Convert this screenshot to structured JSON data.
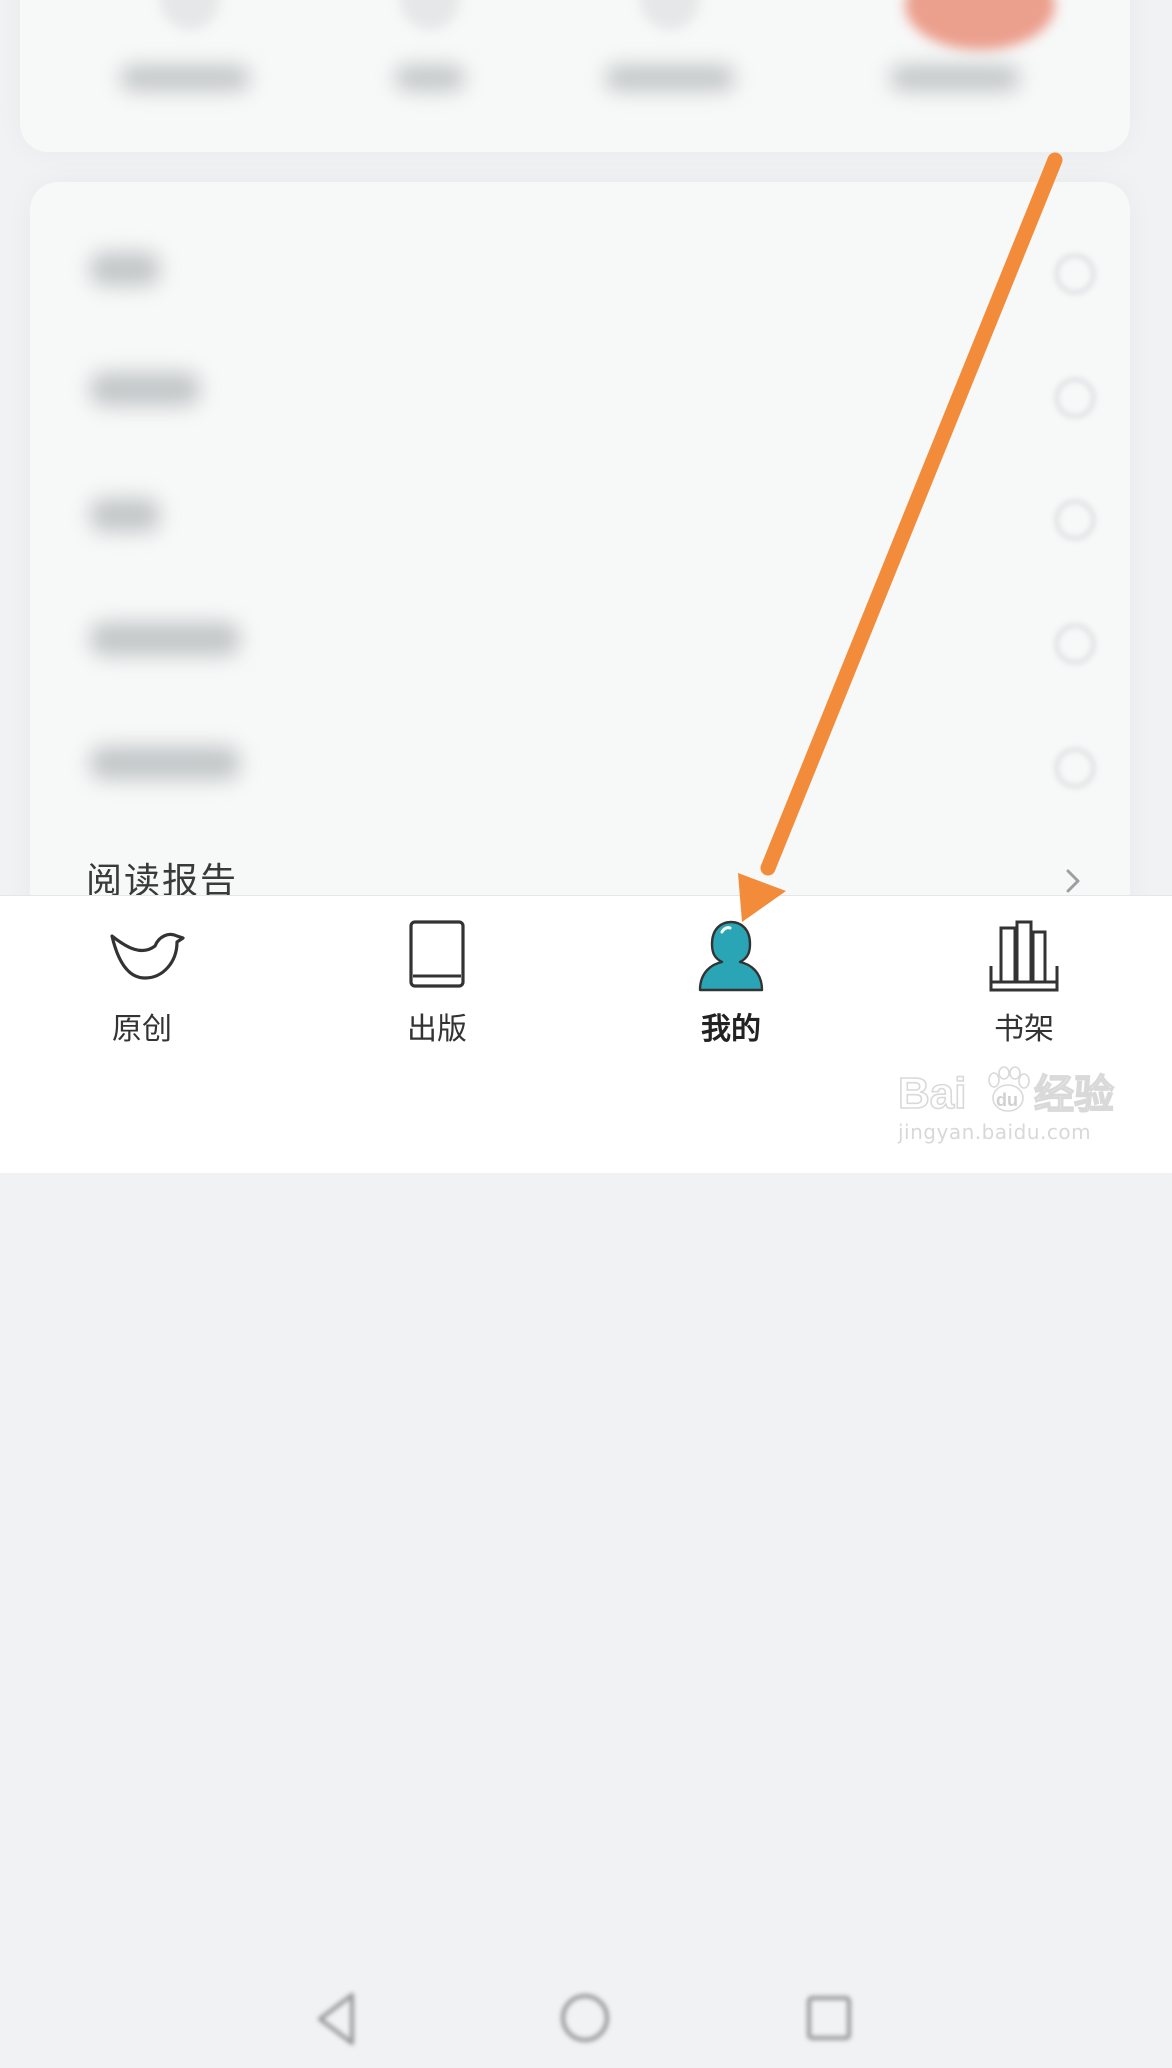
{
  "menu": {
    "reading_report_label": "阅读报告"
  },
  "bottom_nav": {
    "tabs": [
      {
        "label": "原创",
        "icon": "bird-icon",
        "active": false
      },
      {
        "label": "出版",
        "icon": "book-icon",
        "active": false
      },
      {
        "label": "我的",
        "icon": "person-icon",
        "active": true
      },
      {
        "label": "书架",
        "icon": "bookshelf-icon",
        "active": false
      }
    ]
  },
  "system_nav": {
    "buttons": [
      "back-triangle-icon",
      "home-circle-icon",
      "recents-square-icon"
    ]
  },
  "watermark": {
    "logo_text": "Baidu经验",
    "url": "jingyan.baidu.com"
  },
  "colors": {
    "accent_active": "#2aa5b5",
    "arrow": "#f28c3a"
  }
}
